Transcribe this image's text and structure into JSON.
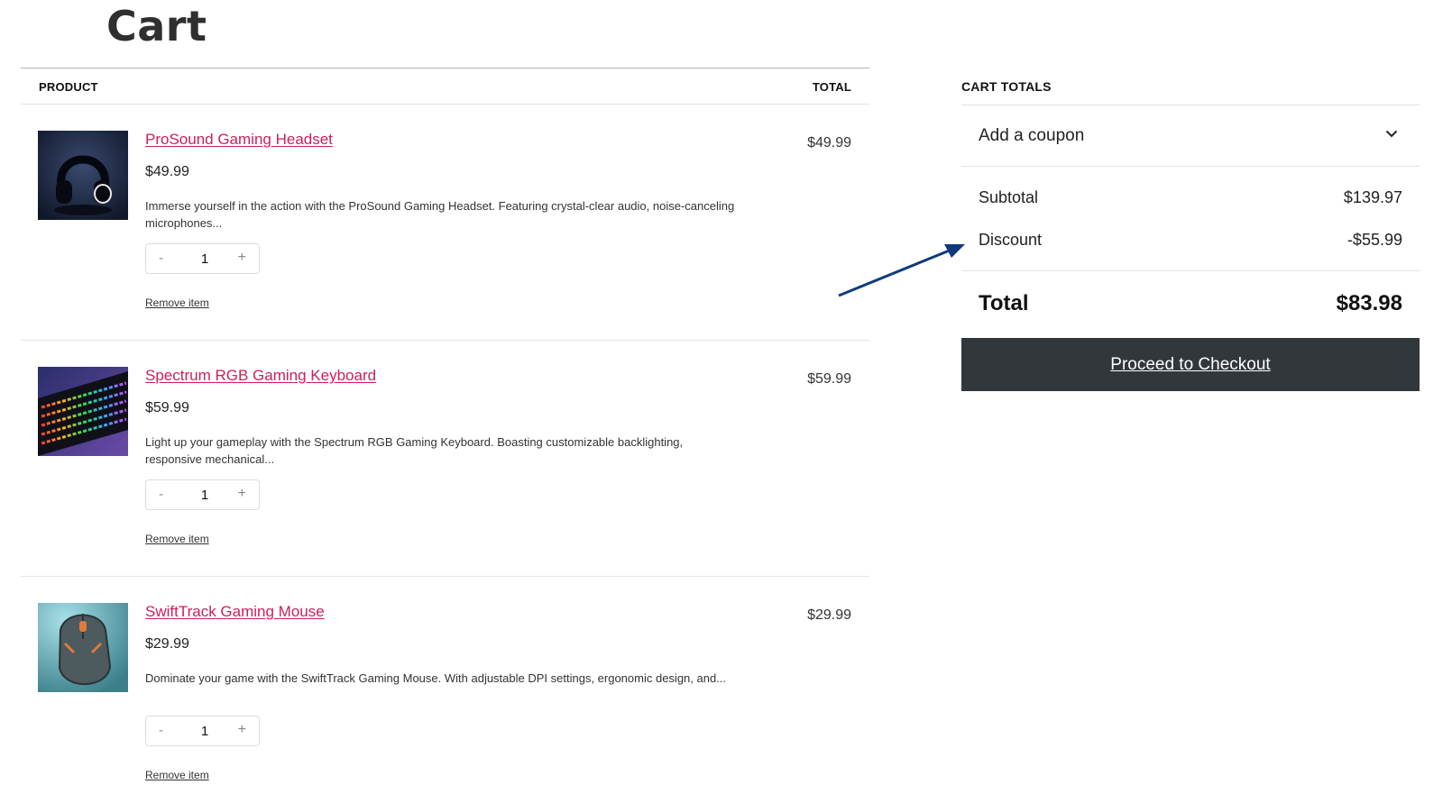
{
  "page": {
    "title": "Cart"
  },
  "cart": {
    "columns": {
      "product": "PRODUCT",
      "total": "TOTAL"
    },
    "items": [
      {
        "name": "ProSound Gaming Headset",
        "price": "$49.99",
        "description": "Immerse yourself in the action with the ProSound Gaming Headset. Featuring crystal-clear audio, noise-canceling microphones...",
        "quantity": "1",
        "remove_label": "Remove item",
        "line_total": "$49.99",
        "image": "headset-image"
      },
      {
        "name": "Spectrum RGB Gaming Keyboard",
        "price": "$59.99",
        "description": "Light up your gameplay with the Spectrum RGB Gaming Keyboard. Boasting customizable backlighting, responsive mechanical...",
        "quantity": "1",
        "remove_label": "Remove item",
        "line_total": "$59.99",
        "image": "keyboard-image"
      },
      {
        "name": "SwiftTrack Gaming Mouse",
        "price": "$29.99",
        "description": "Dominate your game with the SwiftTrack Gaming Mouse. With adjustable DPI settings, ergonomic design, and...",
        "quantity": "1",
        "remove_label": "Remove item",
        "line_total": "$29.99",
        "image": "mouse-image"
      }
    ],
    "qty_minus": "-",
    "qty_plus": "+"
  },
  "totals": {
    "heading": "CART TOTALS",
    "coupon_label": "Add a coupon",
    "subtotal_label": "Subtotal",
    "subtotal_value": "$139.97",
    "discount_label": "Discount",
    "discount_value": "-$55.99",
    "total_label": "Total",
    "total_value": "$83.98",
    "checkout_label": "Proceed to Checkout"
  },
  "colors": {
    "link": "#cc1f5a",
    "checkout_bg": "#32373c",
    "annotation_arrow": "#0f3b7a"
  },
  "icons": {
    "coupon_toggle": "chevron-down-icon",
    "annotation": "arrow-annotation"
  }
}
